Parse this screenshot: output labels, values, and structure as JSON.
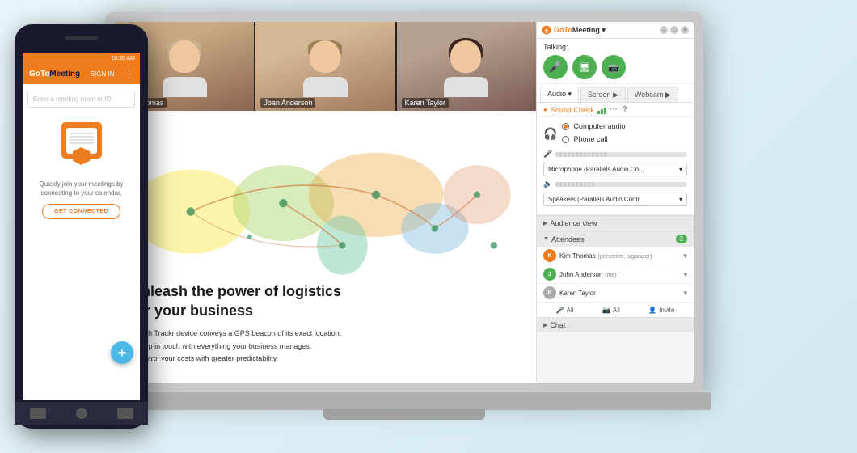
{
  "phone": {
    "logo": "GoTo",
    "logo_bold": "Meeting",
    "signin_label": "SIGN IN",
    "status_time": "10:35 AM",
    "search_placeholder": "Enter a meeting room or ID",
    "body_text": "Quickly join your meetings by connecting to your calendar.",
    "connect_btn": "GET CONNECTED",
    "fab_icon": "+",
    "nav_items": [
      "back",
      "home",
      "recent"
    ]
  },
  "video_attendees": [
    {
      "name": "Kim Thomas",
      "type": "kim"
    },
    {
      "name": "Joan Anderson",
      "type": "joan"
    },
    {
      "name": "Karen Taylor",
      "type": "karen"
    }
  ],
  "slide": {
    "heading_line1": "Unleash the power of logistics",
    "heading_line2": "for your business",
    "bullets": [
      "Each Trackr device conveys a GPS beacon of its exact location.",
      "Keep in touch with everything your business manages.",
      "Control your costs with greater predictability."
    ]
  },
  "gtm": {
    "app_name_goto": "GoTo",
    "app_name_meeting": "Meeting",
    "app_name_suffix": "▾",
    "talking_label": "Talking:",
    "tabs": [
      {
        "label": "Audio ▾",
        "active": true
      },
      {
        "label": "Screen ▶",
        "active": false
      },
      {
        "label": "Webcam ▶",
        "active": false
      }
    ],
    "sound_check_label": "Sound Check",
    "audio_options": [
      {
        "label": "Computer audio",
        "selected": true
      },
      {
        "label": "Phone call",
        "selected": false
      }
    ],
    "microphone_label": "Microphone (Parallels Audio Co...",
    "speakers_label": "Speakers (Parallels Audio Contr...",
    "audience_view_label": "Audience view",
    "attendees_label": "Attendees",
    "attendees_count": "3",
    "attendees": [
      {
        "name": "Kim Thomas",
        "badge": "(presenter, organizer)",
        "color": "#f07c20"
      },
      {
        "name": "John Anderson",
        "badge": "(me)",
        "color": "#4caf50"
      },
      {
        "name": "Karen Taylor",
        "badge": "",
        "color": "#4caf50"
      }
    ],
    "footer_all1": "All",
    "footer_all2": "All",
    "footer_invite": "Invite",
    "chat_label": "Chat",
    "window_minimize": "–",
    "window_restore": "□",
    "window_close": "×"
  }
}
